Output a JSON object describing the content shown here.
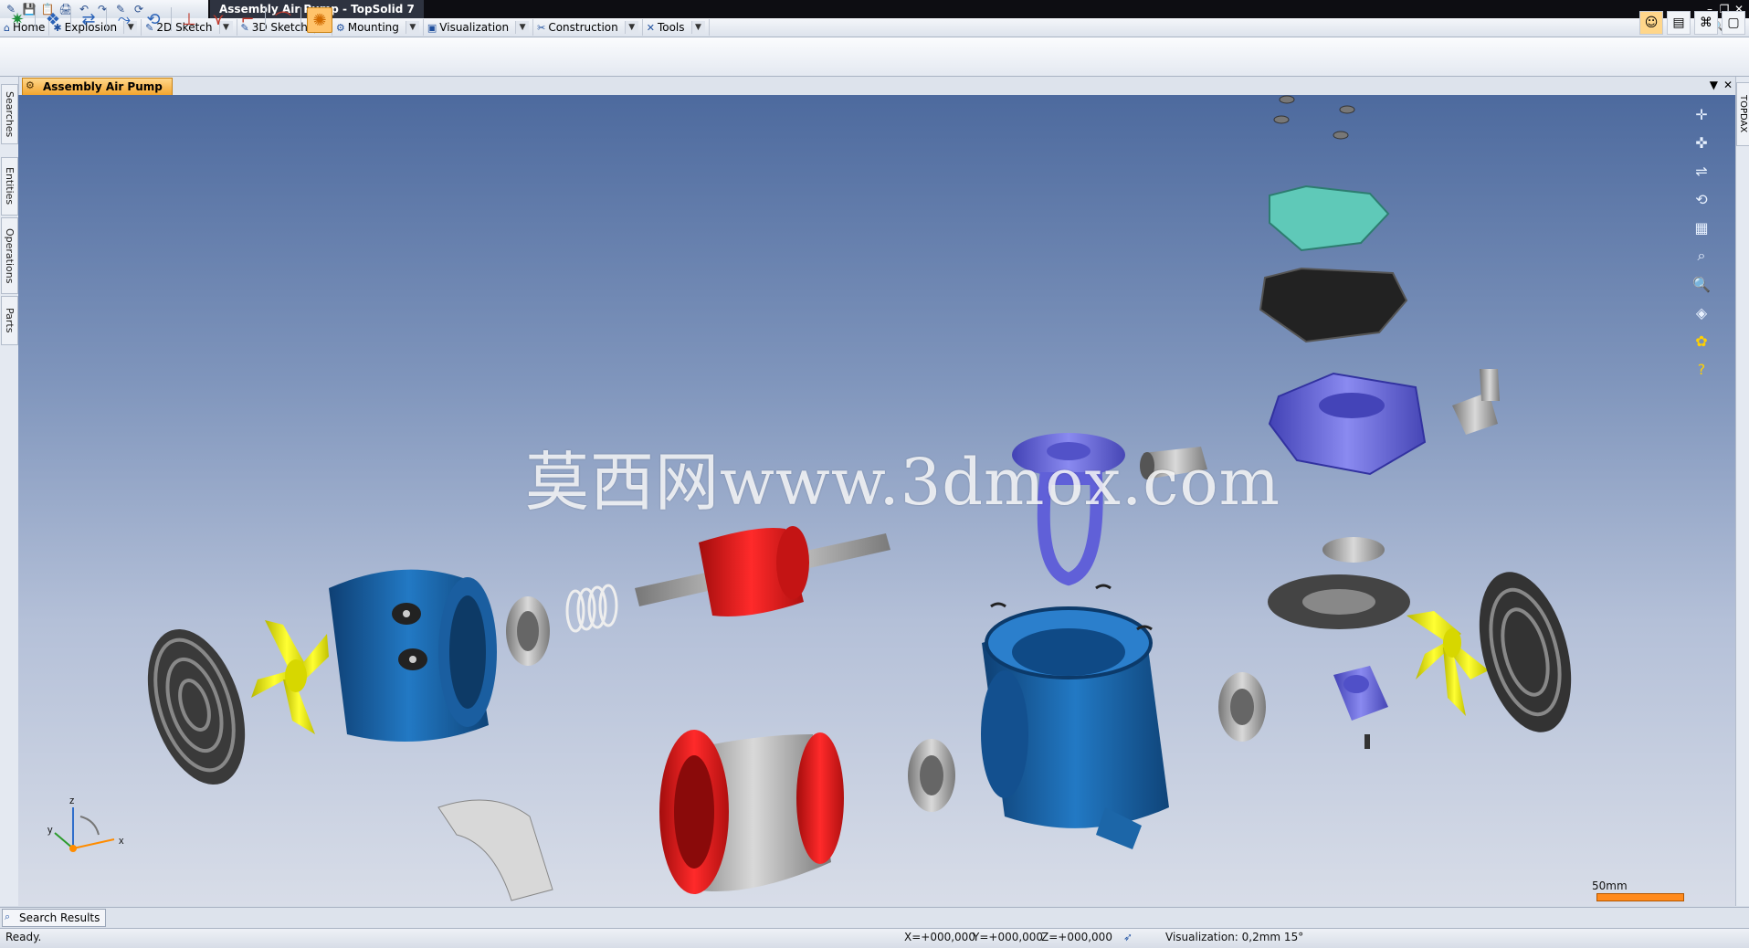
{
  "window": {
    "title": "Assembly Air Pump - TopSolid 7",
    "controls": [
      "–",
      "❐",
      "✕"
    ]
  },
  "quick_access": [
    "💾",
    "📋",
    "🖨",
    "↶",
    "↷",
    "✎",
    "⟳"
  ],
  "menu": {
    "items": [
      {
        "label": "Home",
        "icon": "⌂"
      },
      {
        "label": "Explosion",
        "icon": "✱"
      },
      {
        "label": "2D Sketch",
        "icon": "✎"
      },
      {
        "label": "3D Sketch",
        "icon": "✎"
      },
      {
        "label": "Mounting",
        "icon": "⚙"
      },
      {
        "label": "Visualization",
        "icon": "▣"
      },
      {
        "label": "Construction",
        "icon": "✂"
      },
      {
        "label": "Tools",
        "icon": "✕"
      }
    ]
  },
  "document": {
    "tab_label": "Assembly Air Pump"
  },
  "side_tabs": [
    "Searches",
    "Entities",
    "Operations",
    "Parts"
  ],
  "right_tab": "TOPDAX",
  "watermark": "莫西网www.3dmox.com",
  "scale": {
    "label": "50mm"
  },
  "axis": {
    "z": "z",
    "y": "y",
    "x": "x"
  },
  "bottom": {
    "search_results": "Search Results"
  },
  "status": {
    "ready": "Ready.",
    "x": "X=+000,000",
    "y": "Y=+000,000",
    "z": "Z=+000,000",
    "visualization": "Visualization: 0,2mm 15°"
  },
  "colors": {
    "blue_part": "#1c66a8",
    "red_part": "#e01818",
    "purple_part": "#6f6fe0",
    "yellow_part": "#f2f21c",
    "teal_part": "#5fc9b8"
  }
}
